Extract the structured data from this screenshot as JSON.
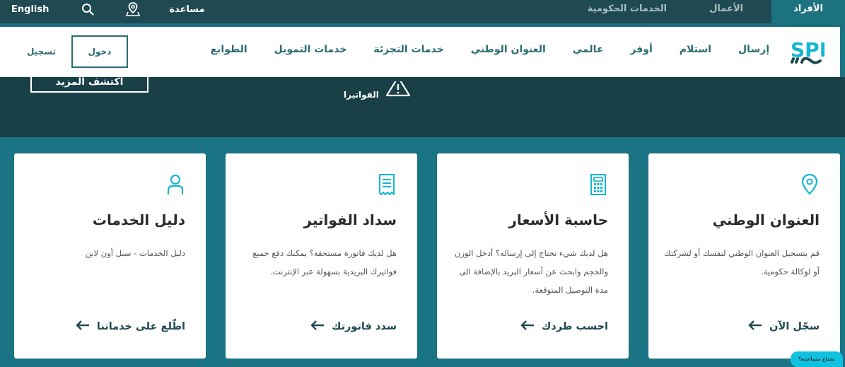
{
  "topbar": {
    "language_label": "English",
    "help_label": "مساعدة",
    "tabs": [
      {
        "label": "الأفراد",
        "active": true
      },
      {
        "label": "الأعمال",
        "active": false
      },
      {
        "label": "الخدمات الحكومية",
        "active": false
      }
    ],
    "icons": [
      "search-icon",
      "map-pin-icon"
    ]
  },
  "nav": {
    "logo_text": "SPL",
    "items": [
      "إرسال",
      "استلام",
      "أوفر",
      "عالمي",
      "العنوان الوطني",
      "خدمات التجزئة",
      "خدمات التمويل",
      "الطوابع"
    ],
    "login_label": "دخول",
    "register_label": "تسجيل"
  },
  "hero": {
    "button_label": "اكتشف المزيد",
    "alert_text": "الفواتيرا"
  },
  "cards": [
    {
      "icon": "location-pin-icon",
      "title": "العنوان الوطني",
      "description": "قم بتسجيل العنوان الوطني لنفسك أو لشركتك أو لوكالة حكومية.",
      "link_label": "سجّل الآن"
    },
    {
      "icon": "calculator-icon",
      "title": "حاسبة الأسعار",
      "description": "هل لديك شيء تحتاج إلى إرساله؟ أدخل الوزن والحجم وابحث عن أسعار البريد بالإضافة الى مدة التوصيل المتوقعة.",
      "link_label": "احسب طردك"
    },
    {
      "icon": "receipt-icon",
      "title": "سداد الفواتير",
      "description": "هل لديك فاتورة مستحقة؟ يمكنك دفع جميع فواتيرك البريدية بسهولة عبر الإنترنت.",
      "link_label": "سدد فاتورتك"
    },
    {
      "icon": "user-icon",
      "title": "دليل الخدمات",
      "description": "دليل الخدمات - سبل أون لاين",
      "link_label": "اطّلع على خدماتنا"
    }
  ],
  "help_bubble": "تحتاج مساعدة؟",
  "colors": {
    "topbar": "#1f4a52",
    "active_tab": "#1d7280",
    "page_background": "#1a7483",
    "hero": "#193f47",
    "accent_icon": "#13b5d1",
    "nav_text": "#2a6b73"
  }
}
